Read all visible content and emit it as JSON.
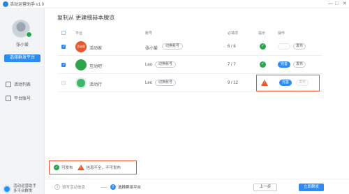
{
  "titlebar": {
    "title": "活动运营助手 v1.0",
    "min": "—",
    "max": "□",
    "close": "✕"
  },
  "sidebar": {
    "username": "张小爱",
    "choose_platform_button": "选择群发平台",
    "nav": [
      {
        "label": "活动列表",
        "icon": "list-icon"
      },
      {
        "label": "平台账号",
        "icon": "account-icon"
      }
    ],
    "brand": {
      "name": "活动运营助手",
      "sub": "多平台群发"
    }
  },
  "main": {
    "title": "复制从 更建细赫本腺览",
    "columns": {
      "platform": "平台",
      "account": "账号",
      "required": "必填项",
      "hint": "提示",
      "action": "操作"
    },
    "rows": [
      {
        "logo_text": "活动家",
        "logo_color": "#e8562a",
        "name": "活动家",
        "checked": true,
        "account": "张小爱",
        "switch_label": "切换账号",
        "count": "6 / 6",
        "hint": "ok",
        "actions": [
          "",
          "发布"
        ]
      },
      {
        "logo_text": "互动吧",
        "logo_color": "#2ea44f",
        "name": "互动吧",
        "checked": true,
        "account": "Leo",
        "switch_label": "切换账号",
        "count": "7 / 7",
        "hint": "ok",
        "actions": [
          "完善",
          "发布"
        ]
      },
      {
        "logo_text": "活动行",
        "logo_color": "#3fb66b",
        "name": "活动行",
        "checked": false,
        "account": "Leo",
        "switch_label": "切换账号",
        "count": "9 / 12",
        "hint": "warn",
        "actions": [
          "完善",
          "发布"
        ]
      }
    ]
  },
  "legend": {
    "ok_label": "可发布",
    "warn_label": "信息不全，不可发布"
  },
  "steps": [
    {
      "num": "1",
      "label": "填写活动信息"
    },
    {
      "num": "2",
      "label": "选择群发平台"
    }
  ],
  "buttons": {
    "prev": "上一步",
    "next": "立即群发"
  }
}
